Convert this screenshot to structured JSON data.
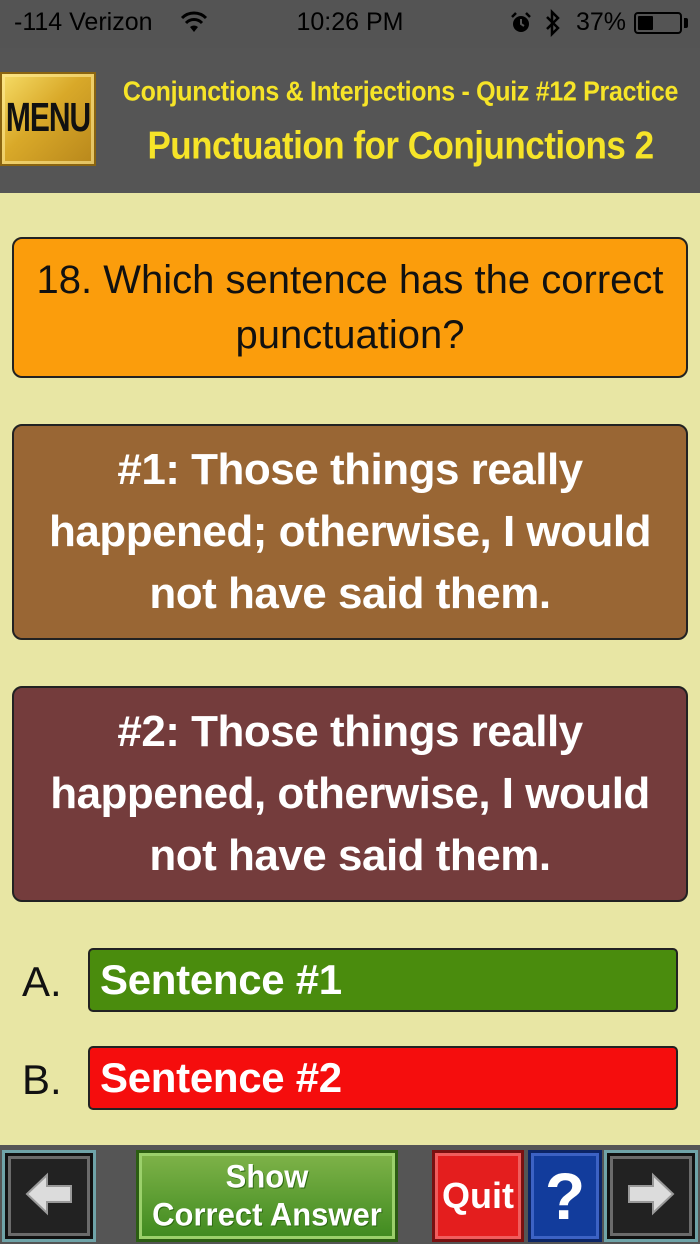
{
  "status_bar": {
    "carrier": "-114 Verizon",
    "time": "10:26 PM",
    "battery_text": "37%",
    "battery_level": 0.37
  },
  "header": {
    "menu_label": "MENU",
    "subtitle": "Conjunctions & Interjections - Quiz #12 Practice",
    "title": "Punctuation for Conjunctions 2"
  },
  "question": {
    "text": "18. Which sentence has the correct punctuation?"
  },
  "options": [
    {
      "text": "#1:  Those things really happened; otherwise, I would not have said them."
    },
    {
      "text": "#2:  Those things really happened, otherwise, I would not have said them."
    }
  ],
  "answers": [
    {
      "letter": "A.",
      "label": "Sentence #1",
      "color": "#4a8c0d"
    },
    {
      "letter": "B.",
      "label": "Sentence #2",
      "color": "#f50d0d"
    }
  ],
  "toolbar": {
    "show_line1": "Show",
    "show_line2": "Correct Answer",
    "quit_label": "Quit",
    "help_label": "?"
  },
  "icons": {
    "prev": "left-arrow-icon",
    "next": "right-arrow-icon",
    "wifi": "wifi-icon",
    "alarm": "alarm-icon",
    "bluetooth": "bluetooth-icon",
    "battery": "battery-icon"
  }
}
